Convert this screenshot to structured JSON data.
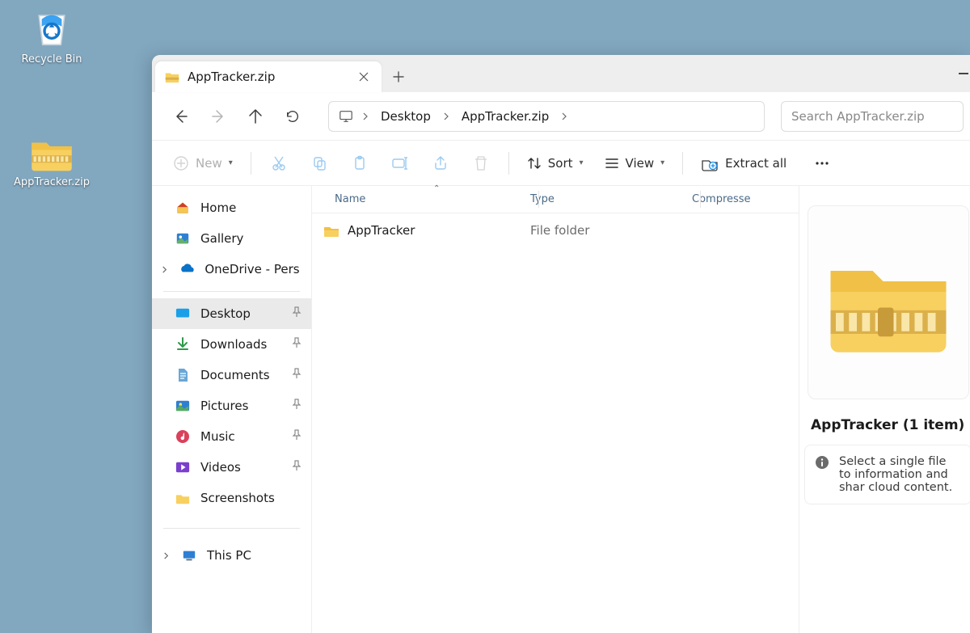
{
  "desktop": {
    "icons": [
      {
        "name": "recycle-bin",
        "label": "Recycle Bin"
      },
      {
        "name": "apptracker-zip",
        "label": "AppTracker.zip"
      }
    ]
  },
  "window": {
    "tab_title": "AppTracker.zip",
    "search_placeholder": "Search AppTracker.zip"
  },
  "breadcrumb": {
    "segments": [
      "Desktop",
      "AppTracker.zip"
    ]
  },
  "toolbar": {
    "new_label": "New",
    "sort_label": "Sort",
    "view_label": "View",
    "extract_label": "Extract all"
  },
  "sidebar": {
    "home": "Home",
    "gallery": "Gallery",
    "onedrive": "OneDrive - Persona",
    "pinned": [
      {
        "label": "Desktop",
        "active": true
      },
      {
        "label": "Downloads"
      },
      {
        "label": "Documents"
      },
      {
        "label": "Pictures"
      },
      {
        "label": "Music"
      },
      {
        "label": "Videos"
      },
      {
        "label": "Screenshots",
        "no_pin": true
      }
    ],
    "thispc": "This PC"
  },
  "columns": {
    "name": "Name",
    "type": "Type",
    "compressed": "Compresse"
  },
  "rows": [
    {
      "name": "AppTracker",
      "type": "File folder"
    }
  ],
  "details": {
    "title": "AppTracker (1 item)",
    "info": "Select a single file to information and shar cloud content."
  }
}
